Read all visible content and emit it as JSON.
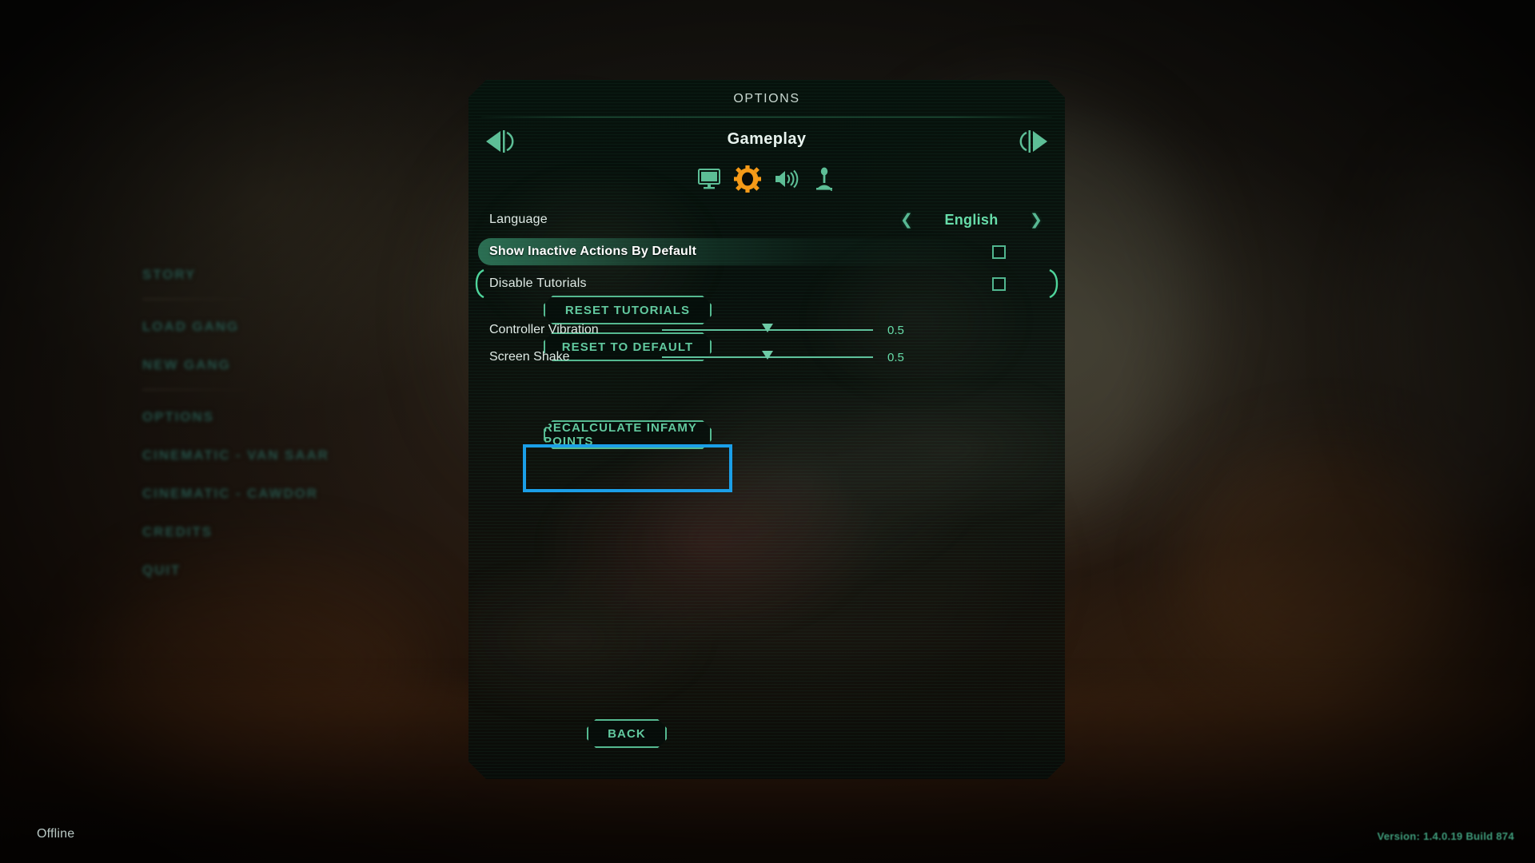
{
  "background_menu": {
    "items": [
      {
        "label": "STORY"
      },
      {
        "label": "LOAD GANG"
      },
      {
        "label": "NEW GANG"
      },
      {
        "label": "OPTIONS"
      },
      {
        "label": "CINEMATIC - VAN SAAR"
      },
      {
        "label": "CINEMATIC - CAWDOR"
      },
      {
        "label": "CREDITS"
      },
      {
        "label": "QUIT"
      }
    ]
  },
  "dialog": {
    "title": "OPTIONS",
    "category": "Gameplay",
    "prev_arrow_icon": "arrow-left-icon",
    "next_arrow_icon": "arrow-right-icon",
    "tabs": [
      {
        "name": "video",
        "icon": "monitor-icon",
        "active": false
      },
      {
        "name": "gameplay",
        "icon": "gear-icon",
        "active": true
      },
      {
        "name": "audio",
        "icon": "speaker-icon",
        "active": false
      },
      {
        "name": "controls",
        "icon": "joystick-skull-icon",
        "active": false
      }
    ],
    "tab_active_color": "#f59a18",
    "tab_inactive_color": "#5dbe96",
    "options": [
      {
        "label": "Language",
        "type": "spinner",
        "value": "English",
        "left_arrow": "❮",
        "right_arrow": "❯",
        "highlighted": false,
        "bracketed": false
      },
      {
        "label": "Show Inactive Actions By Default",
        "type": "checkbox",
        "checked": false,
        "highlighted": true,
        "bracketed": false
      },
      {
        "label": "Disable Tutorials",
        "type": "checkbox",
        "checked": false,
        "highlighted": false,
        "bracketed": true
      }
    ],
    "buttons": {
      "reset_tutorials": "RESET TUTORIALS",
      "reset_to_default": "RESET TO DEFAULT",
      "recalculate_infamy": "RECALCULATE INFAMY POINTS",
      "back": "BACK"
    },
    "sliders": [
      {
        "label": "Controller Vibration",
        "value": "0.5",
        "fraction": 0.5
      },
      {
        "label": "Screen Shake",
        "value": "0.5",
        "fraction": 0.5
      }
    ]
  },
  "focus": {
    "target": "RECALCULATE INFAMY POINTS",
    "color": "#1b9fe8"
  },
  "status": {
    "connection": "Offline",
    "version": "Version: 1.4.0.19 Build 874"
  }
}
